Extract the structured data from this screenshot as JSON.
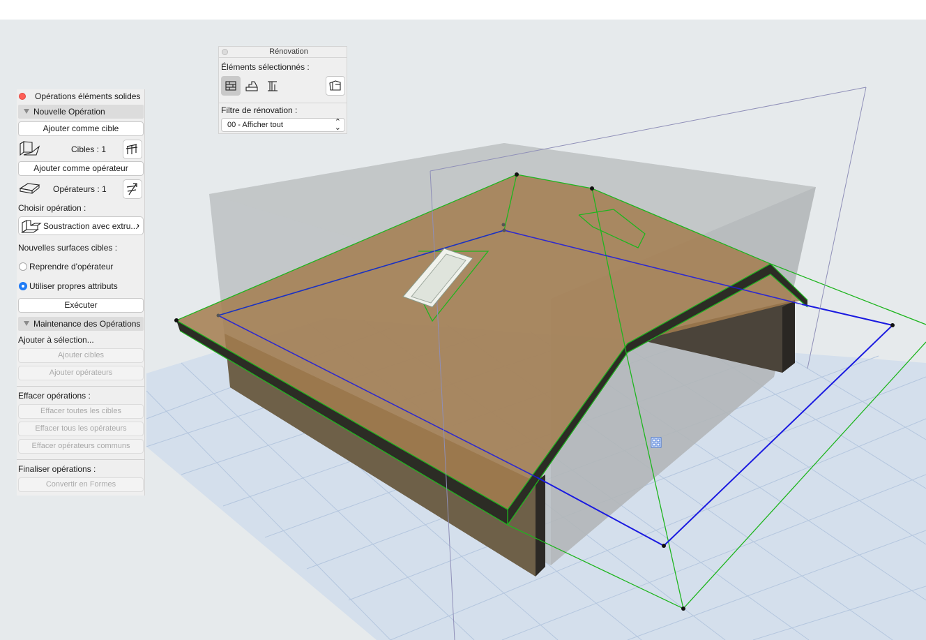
{
  "palette": {
    "title": "Opérations éléments solides",
    "new_op_section": "Nouvelle Opération",
    "add_target_button": "Ajouter comme cible",
    "targets_count": "Cibles : 1",
    "add_operator_button": "Ajouter comme opérateur",
    "operators_count": "Opérateurs : 1",
    "choose_operation_label": "Choisir opération :",
    "operation_value": "Soustraction avec extru...",
    "new_surfaces_label": "Nouvelles surfaces cibles :",
    "radio_option_1": "Reprendre d'opérateur",
    "radio_option_2": "Utiliser propres attributs",
    "selected_radio": "Utiliser propres attributs",
    "execute_button": "Exécuter",
    "maintenance_section": "Maintenance des Opérations",
    "add_to_selection_label": "Ajouter à sélection...",
    "add_targets_button": "Ajouter cibles",
    "add_operators_button": "Ajouter opérateurs",
    "delete_ops_label": "Effacer opérations :",
    "delete_all_targets_button": "Effacer toutes les cibles",
    "delete_all_operators_button": "Effacer tous les opérateurs",
    "delete_common_operators_button": "Effacer opérateurs communs",
    "finalize_label": "Finaliser opérations :",
    "convert_button": "Convertir en Formes"
  },
  "renovation": {
    "title": "Rénovation",
    "selected_label": "Éléments sélectionnés :",
    "filter_label": "Filtre de rénovation :",
    "filter_value": "00 - Afficher tout"
  },
  "icons": [
    "target-element-icon",
    "pick-target-icon",
    "operator-element-icon",
    "pick-operator-icon",
    "subtract-extrusion-icon",
    "wall-icon",
    "stair-icon",
    "beam-icon",
    "renovation-settings-icon",
    "object-hotspot-icon"
  ],
  "colors": {
    "viewport_bg": "#e6eaec",
    "grid_floor": "#c8d7ea",
    "roof_fill": "#a37c4f",
    "roof_edge_green": "#1fb51f",
    "selection_blue": "#1a1ae0",
    "wall_dark": "#4f4537",
    "gray_volume": "#b4b8bb",
    "close_red": "#fe5f57",
    "radio_blue": "#1f7bf5"
  }
}
